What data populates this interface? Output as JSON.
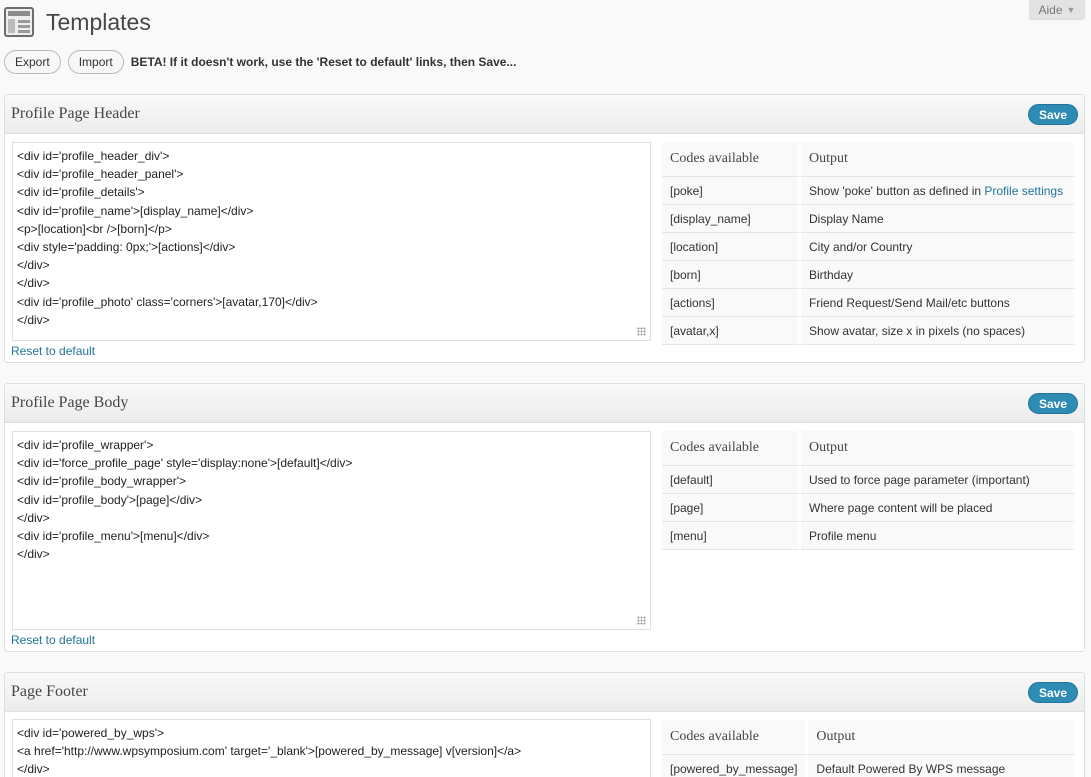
{
  "page": {
    "title": "Templates",
    "help_label": "Aide"
  },
  "toolbar": {
    "export_label": "Export",
    "import_label": "Import",
    "beta_notice": "BETA! If it doesn't work, use the 'Reset to default' links, then Save..."
  },
  "boxes": [
    {
      "title": "Profile Page Header",
      "save_label": "Save",
      "reset_label": "Reset to default",
      "code": "<div id='profile_header_div'>\n<div id='profile_header_panel'>\n<div id='profile_details'>\n<div id='profile_name'>[display_name]</div>\n<p>[location]<br />[born]</p>\n<div style='padding: 0px;'>[actions]</div>\n</div>\n</div>\n<div id='profile_photo' class='corners'>[avatar,170]</div>\n</div>",
      "codes_header": "Codes available",
      "output_header": "Output",
      "codes": [
        {
          "code": "[poke]",
          "output": "Show 'poke' button as defined in ",
          "link": "Profile settings"
        },
        {
          "code": "[display_name]",
          "output": "Display Name"
        },
        {
          "code": "[location]",
          "output": "City and/or Country"
        },
        {
          "code": "[born]",
          "output": "Birthday"
        },
        {
          "code": "[actions]",
          "output": "Friend Request/Send Mail/etc buttons"
        },
        {
          "code": "[avatar,x]",
          "output": "Show avatar, size x in pixels (no spaces)"
        }
      ]
    },
    {
      "title": "Profile Page Body",
      "save_label": "Save",
      "reset_label": "Reset to default",
      "code": "<div id='profile_wrapper'>\n<div id='force_profile_page' style='display:none'>[default]</div>\n<div id='profile_body_wrapper'>\n<div id='profile_body'>[page]</div>\n</div>\n<div id='profile_menu'>[menu]</div>\n</div>",
      "codes_header": "Codes available",
      "output_header": "Output",
      "codes": [
        {
          "code": "[default]",
          "output": "Used to force page parameter (important)"
        },
        {
          "code": "[page]",
          "output": "Where page content will be placed"
        },
        {
          "code": "[menu]",
          "output": "Profile menu"
        }
      ]
    },
    {
      "title": "Page Footer",
      "save_label": "Save",
      "reset_label": "",
      "code": "<div id='powered_by_wps'>\n<a href='http://www.wpsymposium.com' target='_blank'>[powered_by_message] v[version]</a>\n</div>",
      "codes_header": "Codes available",
      "output_header": "Output",
      "codes": [
        {
          "code": "[powered_by_message]",
          "output": "Default Powered By WPS message"
        }
      ]
    }
  ]
}
